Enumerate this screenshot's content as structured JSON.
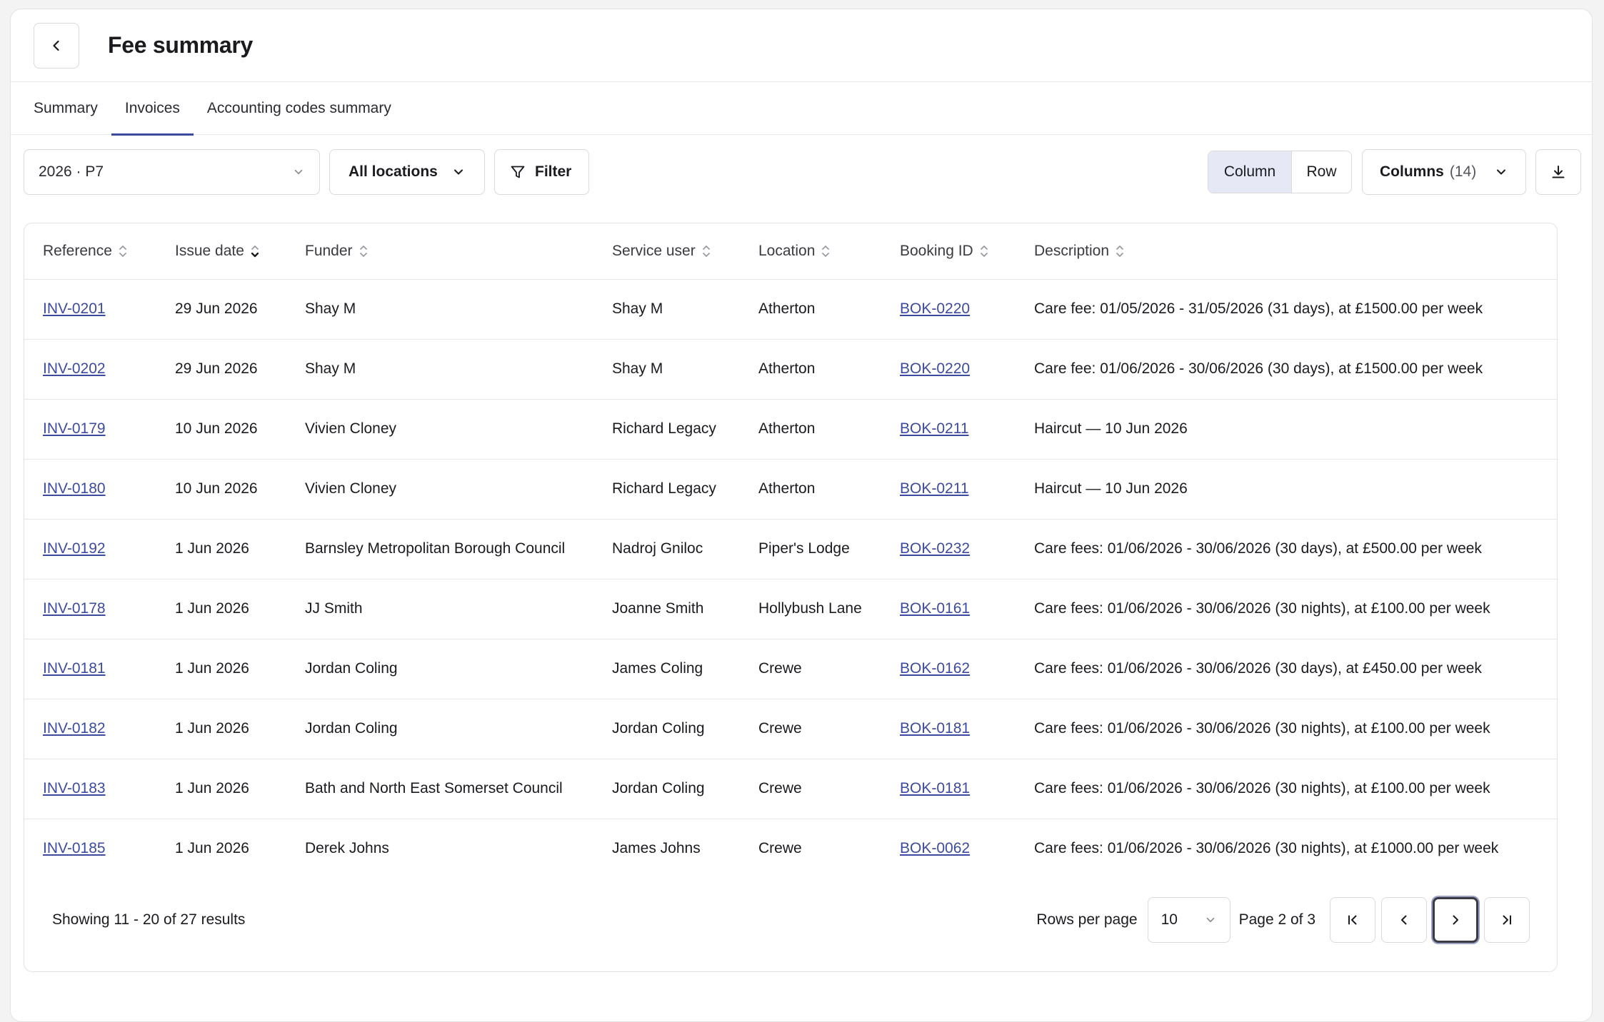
{
  "header": {
    "title": "Fee summary"
  },
  "tabs": [
    {
      "label": "Summary",
      "active": false
    },
    {
      "label": "Invoices",
      "active": true
    },
    {
      "label": "Accounting codes summary",
      "active": false
    }
  ],
  "toolbar": {
    "period_value": "2026 · P7",
    "locations_label": "All locations",
    "filter_label": "Filter",
    "view_column_label": "Column",
    "view_row_label": "Row",
    "columns_label": "Columns",
    "columns_count": "(14)"
  },
  "table": {
    "headers": [
      "Reference",
      "Issue date",
      "Funder",
      "Service user",
      "Location",
      "Booking ID",
      "Description"
    ],
    "rows": [
      [
        "INV-0201",
        "29 Jun 2026",
        "Shay M",
        "Shay M",
        "Atherton",
        "BOK-0220",
        "Care fee: 01/05/2026 - 31/05/2026 (31 days), at £1500.00 per week"
      ],
      [
        "INV-0202",
        "29 Jun 2026",
        "Shay M",
        "Shay M",
        "Atherton",
        "BOK-0220",
        "Care fee: 01/06/2026 - 30/06/2026 (30 days), at £1500.00 per week"
      ],
      [
        "INV-0179",
        "10 Jun 2026",
        "Vivien Cloney",
        "Richard Legacy",
        "Atherton",
        "BOK-0211",
        "Haircut — 10 Jun 2026"
      ],
      [
        "INV-0180",
        "10 Jun 2026",
        "Vivien Cloney",
        "Richard Legacy",
        "Atherton",
        "BOK-0211",
        "Haircut — 10 Jun 2026"
      ],
      [
        "INV-0192",
        "1 Jun 2026",
        "Barnsley Metropolitan Borough Council",
        "Nadroj Gniloc",
        "Piper's Lodge",
        "BOK-0232",
        "Care fees: 01/06/2026 - 30/06/2026 (30 days), at £500.00 per week"
      ],
      [
        "INV-0178",
        "1 Jun 2026",
        "JJ Smith",
        "Joanne Smith",
        "Hollybush Lane",
        "BOK-0161",
        "Care fees: 01/06/2026 - 30/06/2026 (30 nights), at £100.00 per week"
      ],
      [
        "INV-0181",
        "1 Jun 2026",
        "Jordan Coling",
        "James Coling",
        "Crewe",
        "BOK-0162",
        "Care fees: 01/06/2026 - 30/06/2026 (30 days), at £450.00 per week"
      ],
      [
        "INV-0182",
        "1 Jun 2026",
        "Jordan Coling",
        "Jordan Coling",
        "Crewe",
        "BOK-0181",
        "Care fees: 01/06/2026 - 30/06/2026 (30 nights), at £100.00 per week"
      ],
      [
        "INV-0183",
        "1 Jun 2026",
        "Bath and North East Somerset Council",
        "Jordan Coling",
        "Crewe",
        "BOK-0181",
        "Care fees: 01/06/2026 - 30/06/2026 (30 nights), at £100.00 per week"
      ],
      [
        "INV-0185",
        "1 Jun 2026",
        "Derek Johns",
        "James Johns",
        "Crewe",
        "BOK-0062",
        "Care fees: 01/06/2026 - 30/06/2026 (30 nights), at £1000.00 per week"
      ]
    ]
  },
  "footer": {
    "results_text": "Showing 11 - 20 of 27 results",
    "rows_per_page_label": "Rows per page",
    "rows_per_page_value": "10",
    "page_info": "Page 2 of 3"
  },
  "colors": {
    "accent": "#3d4b9e",
    "active_segment": "#e6e8f5",
    "border": "#d9d9de"
  },
  "icons": [
    "chevron-left-icon",
    "chevron-down-icon",
    "filter-icon",
    "download-icon",
    "sort-icon",
    "first-page-icon",
    "prev-page-icon",
    "next-page-icon",
    "last-page-icon"
  ]
}
